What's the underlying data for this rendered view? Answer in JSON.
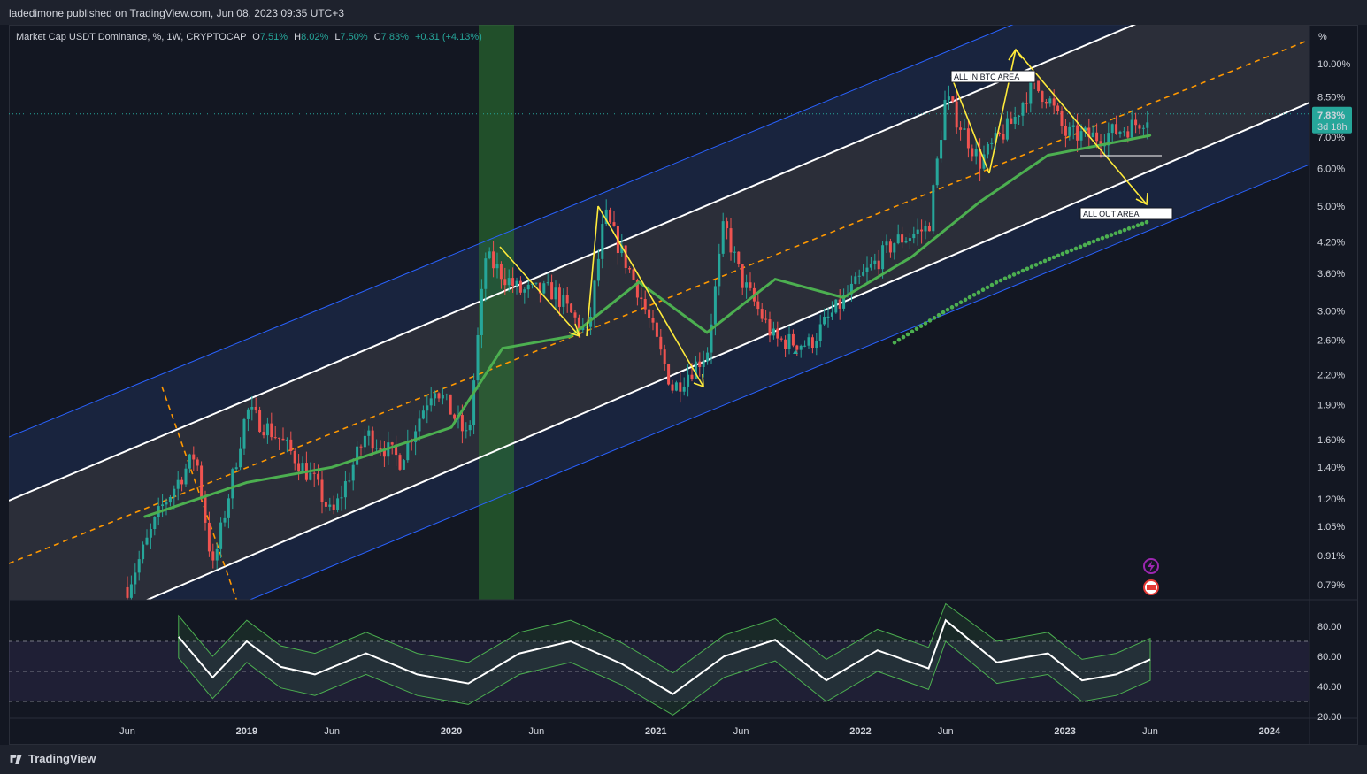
{
  "header": {
    "publish_text": "ladedimone published on TradingView.com, Jun 08, 2023 09:35 UTC+3"
  },
  "legend": {
    "symbol": "Market Cap USDT Dominance, %, 1W, CRYPTOCAP",
    "open_label": "O",
    "open": "7.51%",
    "high_label": "H",
    "high": "8.02%",
    "low_label": "L",
    "low": "7.50%",
    "close_label": "C",
    "close": "7.83%",
    "change": "+0.31 (+4.13%)"
  },
  "price_badge": {
    "value": "7.83%",
    "countdown": "3d 18h"
  },
  "annotations": {
    "top": "ALL IN BTC AREA",
    "bottom": "ALL OUT AREA"
  },
  "brand": "TradingView",
  "colors": {
    "up": "#26a69a",
    "down": "#ef5350",
    "channel_white": "#ffffff",
    "channel_blue": "#2962ff",
    "midline_orange": "#ff9800",
    "ma_green": "#4caf50",
    "arrow_yellow": "#ffeb3b",
    "rsi": "#ffffff"
  },
  "chart_data": [
    {
      "type": "line",
      "title": "Market Cap USDT Dominance, %, 1W, CRYPTOCAP",
      "yscale": "log",
      "ylabel": "%",
      "y_ticks": [
        "10.00%",
        "8.50%",
        "7.00%",
        "6.00%",
        "5.00%",
        "4.20%",
        "3.60%",
        "3.00%",
        "2.60%",
        "2.20%",
        "1.90%",
        "1.60%",
        "1.40%",
        "1.20%",
        "1.05%",
        "0.91%",
        "0.79%"
      ],
      "y_tick_values": [
        10.0,
        8.5,
        7.0,
        6.0,
        5.0,
        4.2,
        3.6,
        3.0,
        2.6,
        2.2,
        1.9,
        1.6,
        1.4,
        1.2,
        1.05,
        0.91,
        0.79
      ],
      "x_ticks": [
        "Jun",
        "2019",
        "Jun",
        "2020",
        "Jun",
        "2021",
        "Jun",
        "2022",
        "Jun",
        "2023",
        "Jun",
        "2024"
      ],
      "x_tick_dates": [
        "2018-06",
        "2019-01",
        "2019-06",
        "2020-01",
        "2020-06",
        "2021-01",
        "2021-06",
        "2022-01",
        "2022-06",
        "2023-01",
        "2023-06",
        "2024-01"
      ],
      "series": [
        {
          "x": [
            "2018-06",
            "2018-08",
            "2018-10",
            "2018-11",
            "2019-01",
            "2019-03",
            "2019-05",
            "2019-06",
            "2019-08",
            "2019-10",
            "2019-12",
            "2020-02",
            "2020-03",
            "2020-05",
            "2020-07",
            "2020-09",
            "2020-10",
            "2020-12",
            "2021-02",
            "2021-04",
            "2021-05",
            "2021-06",
            "2021-08",
            "2021-10",
            "2021-11",
            "2022-01",
            "2022-03",
            "2022-05",
            "2022-06",
            "2022-08",
            "2022-10",
            "2022-11",
            "2022-12",
            "2023-01",
            "2023-03",
            "2023-05",
            "2023-06"
          ],
          "values": [
            0.78,
            1.15,
            1.5,
            0.85,
            1.85,
            1.6,
            1.3,
            1.1,
            1.65,
            1.45,
            2.1,
            1.6,
            3.9,
            3.3,
            3.3,
            2.65,
            4.8,
            3.3,
            2.05,
            2.45,
            4.6,
            3.5,
            2.6,
            2.55,
            2.85,
            3.5,
            4.2,
            4.5,
            8.5,
            6.2,
            7.6,
            9.0,
            8.5,
            7.1,
            7.0,
            7.4,
            7.83
          ]
        },
        {
          "x": [
            "2018-07",
            "2019-01",
            "2019-06",
            "2020-01",
            "2020-04",
            "2020-08",
            "2020-12",
            "2021-04",
            "2021-08",
            "2021-12",
            "2022-04",
            "2022-08",
            "2022-12",
            "2023-06"
          ],
          "values": [
            1.1,
            1.3,
            1.4,
            1.7,
            2.5,
            2.65,
            3.45,
            2.7,
            3.5,
            3.2,
            3.9,
            5.1,
            6.4,
            7.05
          ]
        },
        {
          "x": [
            "2022-03",
            "2022-06",
            "2022-09",
            "2022-12",
            "2023-03",
            "2023-06"
          ],
          "values": [
            2.57,
            3.0,
            3.45,
            3.85,
            4.25,
            4.65
          ]
        }
      ],
      "annotations": [
        "ALL IN BTC AREA",
        "ALL OUT AREA"
      ]
    },
    {
      "type": "line",
      "y_ticks": [
        "80.00",
        "60.00",
        "40.00",
        "20.00"
      ],
      "ylim": [
        20,
        80
      ],
      "series": [
        {
          "x": [
            "2018-09",
            "2018-11",
            "2019-01",
            "2019-03",
            "2019-05",
            "2019-08",
            "2019-11",
            "2020-02",
            "2020-05",
            "2020-08",
            "2020-11",
            "2021-02",
            "2021-05",
            "2021-08",
            "2021-11",
            "2022-02",
            "2022-05",
            "2022-06",
            "2022-09",
            "2022-12",
            "2023-02",
            "2023-04",
            "2023-06"
          ],
          "values": [
            73,
            46,
            70,
            53,
            48,
            62,
            48,
            42,
            62,
            70,
            55,
            35,
            60,
            71,
            44,
            64,
            52,
            84,
            56,
            62,
            44,
            48,
            58
          ]
        }
      ]
    }
  ]
}
